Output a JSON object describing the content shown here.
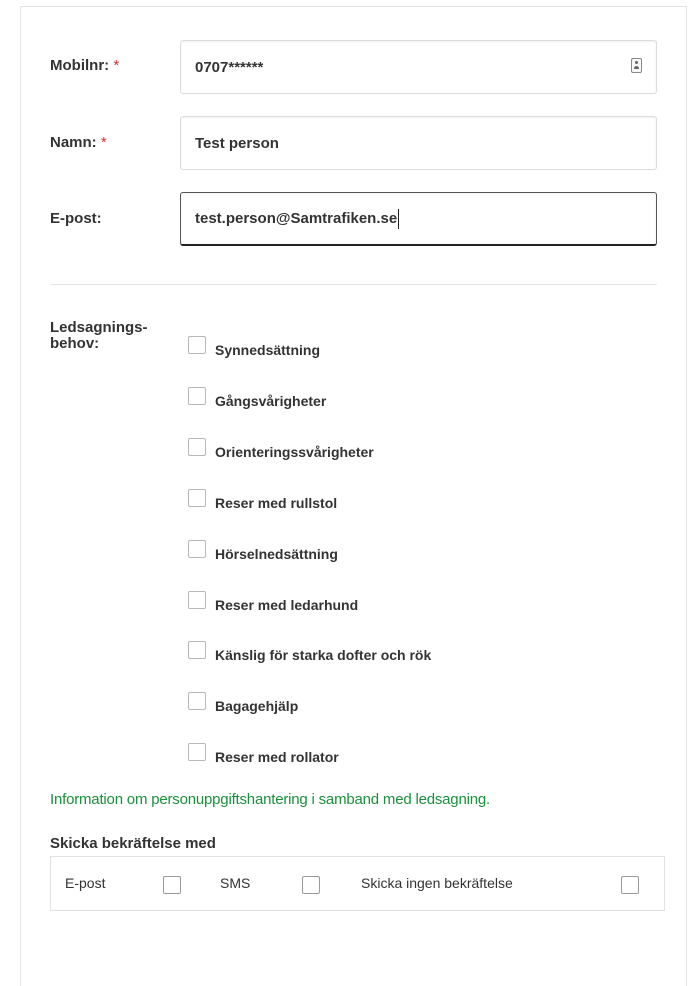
{
  "form": {
    "mobile": {
      "label": "Mobilnr:",
      "required": "*",
      "value": "0707******",
      "icon": "contact-card-icon"
    },
    "name": {
      "label": "Namn:",
      "required": "*",
      "value": "Test person"
    },
    "email": {
      "label": "E-post:",
      "value": "test.person@Samtrafiken.se"
    }
  },
  "needs": {
    "label_line1": "Ledsagnings-",
    "label_line2": "behov:",
    "options": [
      "Synnedsättning",
      "Gångsvårigheter",
      "Orienteringssvårigheter",
      "Reser med rullstol",
      "Hörselnedsättning",
      "Reser med ledarhund",
      "Känslig för starka dofter och rök",
      "Bagagehjälp",
      "Reser med rollator"
    ]
  },
  "info_link": "Information om personuppgiftshantering i samband med ledsagning.",
  "confirmation": {
    "title": "Skicka bekräftelse med",
    "options": [
      "E-post",
      "SMS",
      "Skicka ingen bekräftelse"
    ]
  },
  "colors": {
    "link": "#1a8f3c",
    "required": "#d0312d",
    "text": "#333333"
  }
}
